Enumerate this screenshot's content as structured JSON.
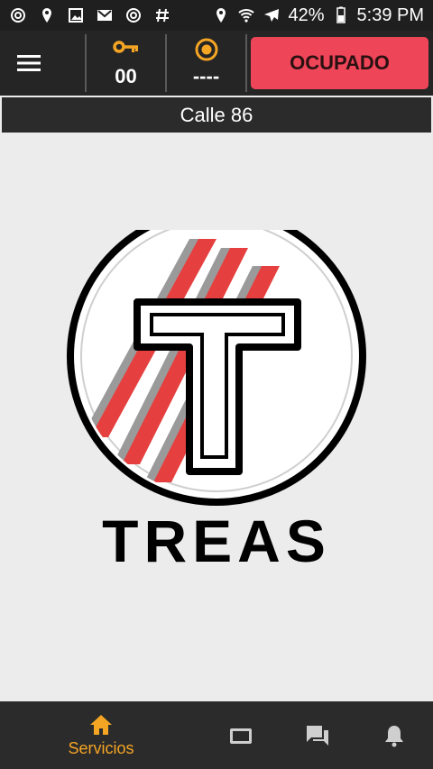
{
  "status_bar": {
    "left_icons": [
      "sync-icon",
      "location-pin-icon",
      "image-icon",
      "gmail-icon",
      "sync-icon",
      "hash-icon"
    ],
    "right_icons": [
      "location-pin-icon",
      "wifi-icon",
      "airplane-icon"
    ],
    "battery": "42%",
    "time": "5:39 PM"
  },
  "toolbar": {
    "menu_icon": "hamburger-menu-icon",
    "key_icon": "key-icon",
    "key_count": "00",
    "target_icon": "radio-target-icon",
    "target_value": "----",
    "status_button": "OCUPADO"
  },
  "street": {
    "name": "Calle 86"
  },
  "logo": {
    "wordmark": "TREAS"
  },
  "bottom_nav": {
    "items": [
      {
        "icon": "home-icon",
        "label": "Servicios"
      },
      {
        "icon": "tablet-icon",
        "label": ""
      },
      {
        "icon": "chat-icon",
        "label": ""
      },
      {
        "icon": "bell-icon",
        "label": ""
      }
    ]
  },
  "colors": {
    "accent": "#f5a524",
    "busy": "#ee4559",
    "bar": "#252525",
    "logo_red": "#e5403f"
  }
}
